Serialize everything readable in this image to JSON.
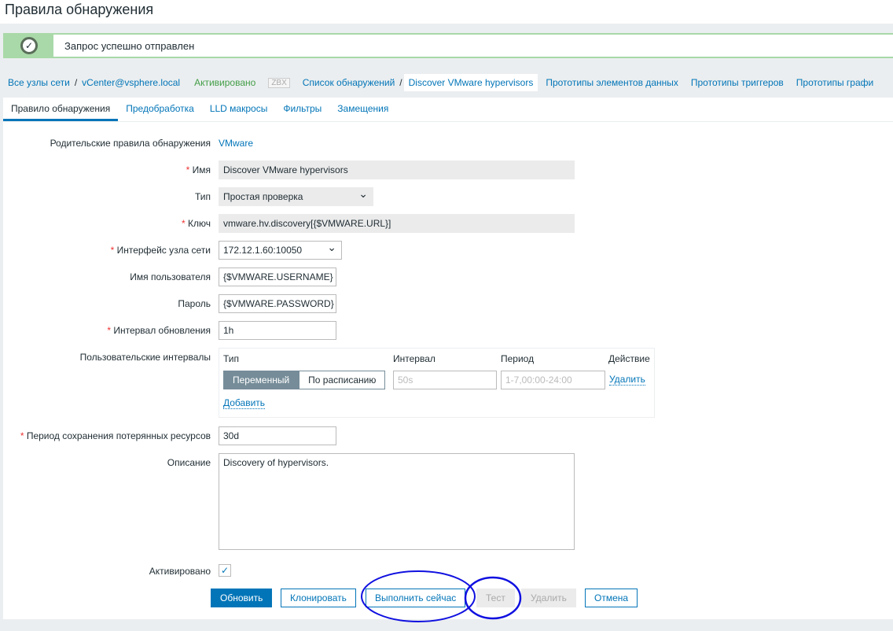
{
  "title": "Правила обнаружения",
  "message": "Запрос успешно отправлен",
  "breadcrumb": {
    "all_hosts": "Все узлы сети",
    "host": "vCenter@vsphere.local",
    "status": "Активировано",
    "zbx": "ZBX",
    "discovery_list": "Список обнаружений",
    "current": "Discover VMware hypervisors",
    "item_prototypes": "Прототипы элементов данных",
    "trigger_prototypes": "Прототипы триггеров",
    "graph_prototypes": "Прототипы графи"
  },
  "tabs": [
    "Правило обнаружения",
    "Предобработка",
    "LLD макросы",
    "Фильтры",
    "Замещения"
  ],
  "form": {
    "parent_label": "Родительские правила обнаружения",
    "parent_value": "VMware",
    "name_label": "Имя",
    "name_value": "Discover VMware hypervisors",
    "type_label": "Тип",
    "type_value": "Простая проверка",
    "key_label": "Ключ",
    "key_value": "vmware.hv.discovery[{$VMWARE.URL}]",
    "iface_label": "Интерфейс узла сети",
    "iface_value": "172.12.1.60:10050",
    "user_label": "Имя пользователя",
    "user_value": "{$VMWARE.USERNAME}",
    "pass_label": "Пароль",
    "pass_value": "{$VMWARE.PASSWORD}",
    "interval_label": "Интервал обновления",
    "interval_value": "1h",
    "custom_label": "Пользовательские интервалы",
    "custom": {
      "col_type": "Тип",
      "col_interval": "Интервал",
      "col_period": "Период",
      "col_action": "Действие",
      "flexible": "Переменный",
      "scheduling": "По расписанию",
      "interval_ph": "50s",
      "period_ph": "1-7,00:00-24:00",
      "remove": "Удалить",
      "add": "Добавить"
    },
    "lifetime_label": "Период сохранения потерянных ресурсов",
    "lifetime_value": "30d",
    "desc_label": "Описание",
    "desc_value": "Discovery of hypervisors.",
    "enabled_label": "Активировано"
  },
  "buttons": {
    "update": "Обновить",
    "clone": "Клонировать",
    "execute": "Выполнить сейчас",
    "test": "Тест",
    "delete": "Удалить",
    "cancel": "Отмена"
  },
  "colors": {
    "accent": "#0275b8",
    "success": "#a9d9a8",
    "annotation": "#1010e0"
  }
}
